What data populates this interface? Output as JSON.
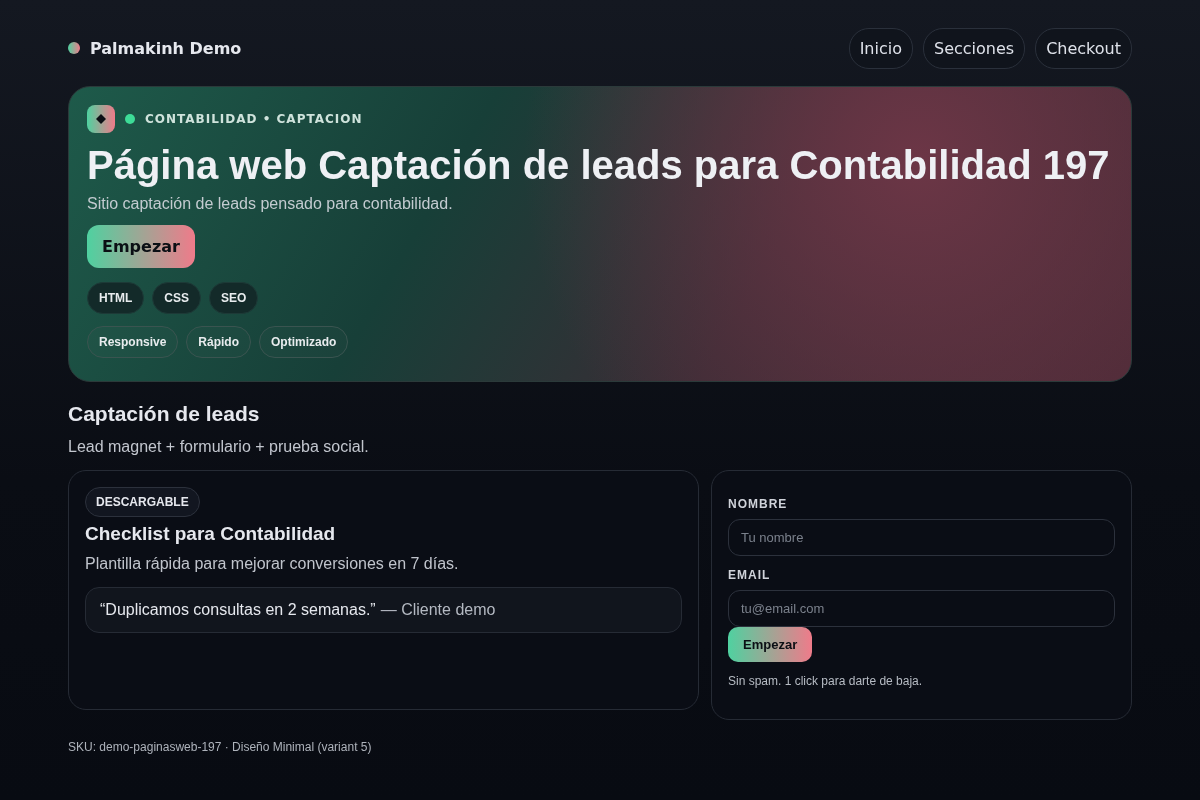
{
  "brand": {
    "name": "Palmakinh Demo"
  },
  "nav": [
    {
      "label": "Inicio"
    },
    {
      "label": "Secciones"
    },
    {
      "label": "Checkout"
    }
  ],
  "hero": {
    "eyebrow": "CONTABILIDAD • CAPTACION",
    "title": "Página web Captación de leads para Contabilidad 197",
    "subtitle": "Sitio captación de leads pensado para contabilidad.",
    "cta": "Empezar",
    "tags": [
      {
        "label": "HTML"
      },
      {
        "label": "CSS"
      },
      {
        "label": "SEO"
      }
    ],
    "features": [
      {
        "label": "Responsive"
      },
      {
        "label": "Rápido"
      },
      {
        "label": "Optimizado"
      }
    ]
  },
  "section": {
    "title": "Captación de leads",
    "subtitle": "Lead magnet + formulario + prueba social."
  },
  "offer": {
    "badge": "DESCARGABLE",
    "title": "Checklist para Contabilidad",
    "text": "Plantilla rápida para mejorar conversiones en 7 días.",
    "quote": "“Duplicamos consultas en 2 semanas.”",
    "author": "— Cliente demo"
  },
  "form": {
    "fields": [
      {
        "label": "NOMBRE",
        "placeholder": "Tu nombre"
      },
      {
        "label": "EMAIL",
        "placeholder": "tu@email.com"
      }
    ],
    "button": "Empezar",
    "note": "Sin spam. 1 click para darte de baja."
  },
  "footer": {
    "text": "SKU: demo-paginasweb-197 · Diseño Minimal (variant 5)"
  }
}
